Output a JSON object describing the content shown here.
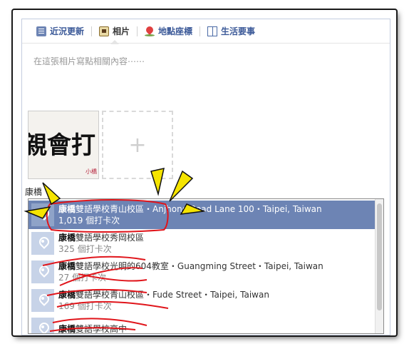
{
  "tabs": [
    {
      "label": "近況更新",
      "icon": "status-icon"
    },
    {
      "label": "相片",
      "icon": "photo-icon"
    },
    {
      "label": "地點座標",
      "icon": "place-pin-icon"
    },
    {
      "label": "生活要事",
      "icon": "life-event-icon"
    }
  ],
  "composer": {
    "placeholder": "在這張相片寫點相關內容⋯⋯"
  },
  "photo": {
    "thumb_text": "親會打",
    "thumb_small": "小橋",
    "add_symbol": "+"
  },
  "search": {
    "query": "康橋"
  },
  "results": [
    {
      "name_bold": "康橋",
      "name_rest": "雙語學校青山校區・Anjhong Road Lane 100・Taipei, Taiwan",
      "count": "1,019 個打卡次"
    },
    {
      "name_bold": "康橋",
      "name_rest": "雙語學校秀岡校區",
      "count": "325 個打卡次"
    },
    {
      "name_bold": "康橋",
      "name_rest": "雙語學校光明的604教室・Guangming Street・Taipei, Taiwan",
      "count": "27 個打卡次"
    },
    {
      "name_bold": "康橋",
      "name_rest": "雙語學校青山校區・Fude Street・Taipei, Taiwan",
      "count": "169 個打卡次"
    },
    {
      "name_bold": "康橋",
      "name_rest": "雙語學校高中",
      "count": ""
    }
  ],
  "colors": {
    "accent": "#3b5998",
    "selected_row": "#6d84b4",
    "annotation_red": "#e0151b",
    "annotation_yellow": "#f5e400"
  }
}
